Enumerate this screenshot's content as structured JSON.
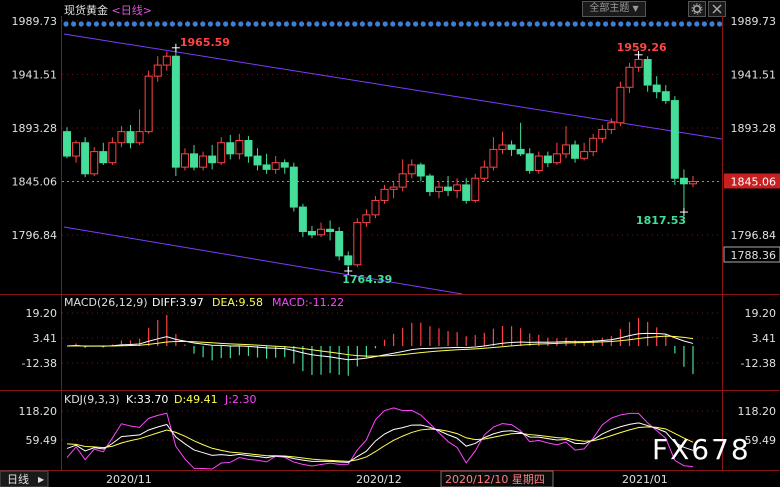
{
  "header": {
    "instrument": "现货黄金",
    "period_label": "<日线>",
    "scheme_button": "全部主题",
    "scheme_arrow": "▼",
    "settings_icon": "gear-icon",
    "close_icon": "close-icon"
  },
  "colors": {
    "up": "#ff4444",
    "down": "#44dd99",
    "channel": "#7b3cff",
    "price_line": "#ff6060",
    "dif": "#ffffff",
    "dea": "#ffff55",
    "k_line": "#ffffff",
    "d_line": "#ffff55",
    "j_line": "#ff44ff",
    "grid": "#7a1010",
    "dots": "#3b7fd6"
  },
  "price_panel": {
    "axis_left": [
      "1989.73",
      "1941.51",
      "1893.28",
      "1845.06",
      "1796.84"
    ],
    "axis_right": [
      "1989.73",
      "1941.51",
      "1893.28",
      "1845.06",
      "1796.84",
      "1788.36"
    ],
    "annotations": {
      "high_left": "1965.59",
      "high_right": "1959.26",
      "low_mid": "1764.39",
      "low_right": "1817.53"
    }
  },
  "macd_panel": {
    "title": "MACD(26,12,9)",
    "diff": "DIFF:3.97",
    "dea": "DEA:9.58",
    "macd": "MACD:-11.22",
    "axis_left": [
      "19.20",
      "3.41",
      "-12.38"
    ],
    "axis_right": [
      "19.20",
      "3.41",
      "-12.38"
    ]
  },
  "kdj_panel": {
    "title": "KDJ(9,3,3)",
    "k": "K:33.70",
    "d": "D:49.41",
    "j": "J:2.30",
    "axis_left": [
      "118.20",
      "59.49"
    ],
    "axis_right": [
      "118.20",
      "59.49"
    ]
  },
  "x_axis": {
    "period_tab": "日线",
    "labels": [
      "2020/11",
      "2020/12",
      "2021/01"
    ],
    "cursor_label": "2020/12/10 星期四"
  },
  "watermark": "FX678",
  "chart_data": {
    "type": "candlestick",
    "ylim": [
      1764.39,
      1989.73
    ],
    "candles": [
      [
        1890,
        1868,
        1894,
        1866
      ],
      [
        1868,
        1880,
        1882,
        1862
      ],
      [
        1880,
        1852,
        1885,
        1849
      ],
      [
        1852,
        1872,
        1876,
        1850
      ],
      [
        1872,
        1862,
        1880,
        1860
      ],
      [
        1862,
        1880,
        1885,
        1860
      ],
      [
        1880,
        1890,
        1895,
        1876
      ],
      [
        1890,
        1880,
        1896,
        1875
      ],
      [
        1880,
        1890,
        1910,
        1878
      ],
      [
        1890,
        1940,
        1945,
        1888
      ],
      [
        1940,
        1950,
        1958,
        1935
      ],
      [
        1950,
        1958,
        1962,
        1945
      ],
      [
        1958,
        1858,
        1965.59,
        1850
      ],
      [
        1858,
        1870,
        1875,
        1855
      ],
      [
        1870,
        1858,
        1878,
        1855
      ],
      [
        1858,
        1868,
        1872,
        1855
      ],
      [
        1868,
        1862,
        1878,
        1856
      ],
      [
        1862,
        1880,
        1885,
        1860
      ],
      [
        1880,
        1870,
        1887,
        1865
      ],
      [
        1870,
        1882,
        1888,
        1865
      ],
      [
        1882,
        1868,
        1886,
        1862
      ],
      [
        1868,
        1860,
        1875,
        1855
      ],
      [
        1860,
        1856,
        1870,
        1852
      ],
      [
        1856,
        1862,
        1868,
        1852
      ],
      [
        1862,
        1858,
        1865,
        1852
      ],
      [
        1858,
        1822,
        1862,
        1818
      ],
      [
        1822,
        1800,
        1825,
        1795
      ],
      [
        1800,
        1797,
        1805,
        1794
      ],
      [
        1797,
        1802,
        1808,
        1795
      ],
      [
        1802,
        1800,
        1810,
        1792
      ],
      [
        1800,
        1778,
        1804,
        1774
      ],
      [
        1778,
        1770,
        1782,
        1764.39
      ],
      [
        1770,
        1808,
        1812,
        1768
      ],
      [
        1808,
        1815,
        1820,
        1804
      ],
      [
        1815,
        1828,
        1832,
        1812
      ],
      [
        1828,
        1838,
        1842,
        1825
      ],
      [
        1838,
        1840,
        1845,
        1830
      ],
      [
        1840,
        1852,
        1865,
        1836
      ],
      [
        1852,
        1860,
        1865,
        1848
      ],
      [
        1860,
        1850,
        1862,
        1845
      ],
      [
        1850,
        1836,
        1852,
        1832
      ],
      [
        1836,
        1840,
        1845,
        1830
      ],
      [
        1840,
        1837,
        1850,
        1832
      ],
      [
        1837,
        1842,
        1848,
        1830
      ],
      [
        1842,
        1828,
        1848,
        1825
      ],
      [
        1828,
        1848,
        1852,
        1826
      ],
      [
        1848,
        1858,
        1864,
        1845
      ],
      [
        1858,
        1874,
        1885,
        1855
      ],
      [
        1874,
        1878,
        1890,
        1870
      ],
      [
        1878,
        1874,
        1882,
        1868
      ],
      [
        1874,
        1870,
        1898,
        1868
      ],
      [
        1870,
        1855,
        1875,
        1852
      ],
      [
        1855,
        1868,
        1872,
        1852
      ],
      [
        1868,
        1862,
        1872,
        1858
      ],
      [
        1862,
        1870,
        1880,
        1860
      ],
      [
        1870,
        1878,
        1895,
        1866
      ],
      [
        1878,
        1866,
        1882,
        1862
      ],
      [
        1866,
        1872,
        1880,
        1864
      ],
      [
        1872,
        1884,
        1888,
        1868
      ],
      [
        1884,
        1892,
        1896,
        1880
      ],
      [
        1892,
        1898,
        1902,
        1888
      ],
      [
        1898,
        1930,
        1935,
        1895
      ],
      [
        1930,
        1948,
        1952,
        1925
      ],
      [
        1948,
        1955,
        1959.26,
        1944
      ],
      [
        1955,
        1932,
        1958,
        1926
      ],
      [
        1932,
        1926,
        1940,
        1920
      ],
      [
        1926,
        1918,
        1932,
        1915
      ],
      [
        1918,
        1848,
        1922,
        1842
      ],
      [
        1848,
        1843,
        1856,
        1817.53
      ],
      [
        1843,
        1845,
        1850,
        1840
      ]
    ]
  }
}
